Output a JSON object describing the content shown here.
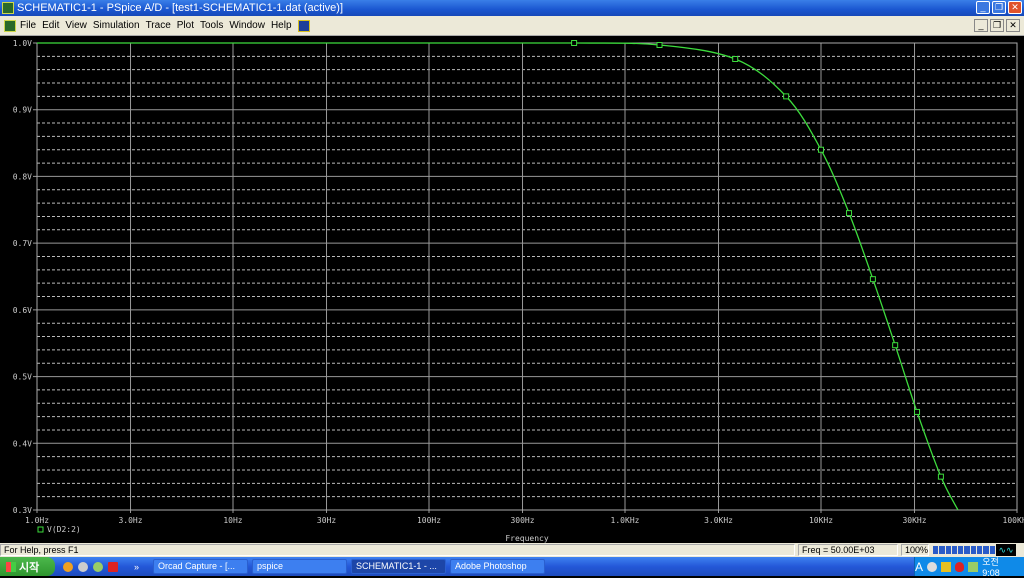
{
  "window": {
    "title": "SCHEMATIC1-1 - PSpice A/D  - [test1-SCHEMATIC1-1.dat (active)]",
    "minimize": "_",
    "restore": "❐",
    "close": "✕"
  },
  "menu": [
    "File",
    "Edit",
    "View",
    "Simulation",
    "Trace",
    "Plot",
    "Tools",
    "Window",
    "Help"
  ],
  "statusbar": {
    "help": "For Help, press F1",
    "freq": "Freq = 50.00E+03",
    "zoom": "100%",
    "progress": 1.0
  },
  "taskbar": {
    "start": "시작",
    "more": "»",
    "buttons": [
      "Orcad Capture - [...",
      "pspice",
      "SCHEMATIC1-1 - ...",
      "Adobe Photoshop"
    ],
    "active_index": 2,
    "tray_ime": "A",
    "clock": "오전 9:08"
  },
  "chart_data": {
    "type": "line",
    "xscale": "log",
    "xlabel": "Frequency",
    "xlim": [
      1,
      100000
    ],
    "ylim": [
      0.3,
      1.0
    ],
    "x_ticks": [
      1,
      3,
      10,
      30,
      100,
      300,
      1000,
      3000,
      10000,
      30000,
      100000
    ],
    "x_tick_labels": [
      "1.0Hz",
      "3.0Hz",
      "10Hz",
      "30Hz",
      "100Hz",
      "300Hz",
      "1.0KHz",
      "3.0KHz",
      "10KHz",
      "30KHz",
      "100KHz"
    ],
    "y_ticks": [
      1.0,
      0.9,
      0.8,
      0.7,
      0.6,
      0.5,
      0.4,
      0.3
    ],
    "y_tick_labels": [
      "1.0V",
      "0.9V",
      "0.8V",
      "0.7V",
      "0.6V",
      "0.5V",
      "0.4V",
      "0.3V"
    ],
    "minor_step": 0.02,
    "grid": true,
    "series": [
      {
        "name": "V(D2:2)",
        "color": "#3ddc3d",
        "x": [
          1,
          10,
          100,
          550,
          1500,
          3650,
          6640,
          10000,
          13900,
          18400,
          23900,
          30900,
          40900,
          50000
        ],
        "y": [
          1.0,
          1.0,
          1.0,
          1.0,
          0.997,
          0.976,
          0.92,
          0.84,
          0.745,
          0.646,
          0.547,
          0.447,
          0.35,
          0.3
        ],
        "marker_x": [
          550,
          1500,
          3650,
          6640,
          10000,
          13900,
          18400,
          23900,
          30900,
          40900
        ],
        "marker_y": [
          1.0,
          0.997,
          0.976,
          0.92,
          0.84,
          0.745,
          0.646,
          0.547,
          0.447,
          0.35
        ]
      }
    ],
    "legend": "bottom-left"
  }
}
